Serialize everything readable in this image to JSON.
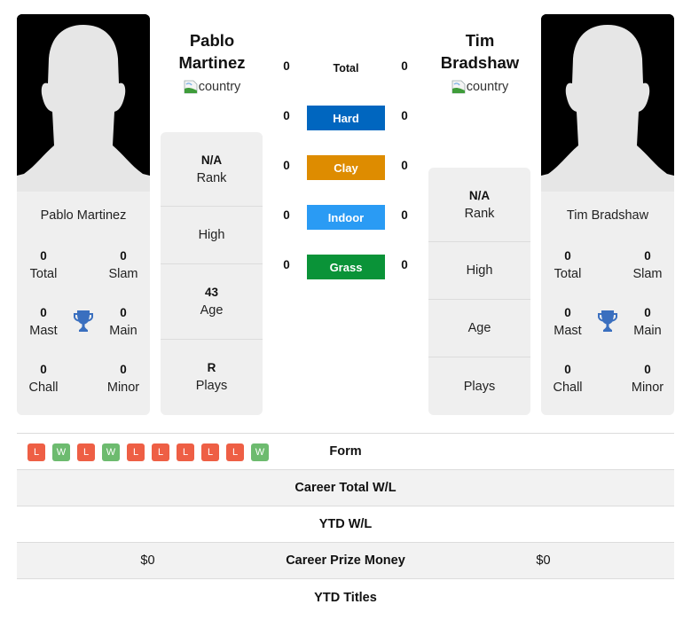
{
  "players": {
    "left": {
      "name": "Pablo Martinez",
      "name_line1": "Pablo",
      "name_line2": "Martinez",
      "country_alt": "country",
      "titles": {
        "total": {
          "value": "0",
          "label": "Total"
        },
        "slam": {
          "value": "0",
          "label": "Slam"
        },
        "mast": {
          "value": "0",
          "label": "Mast"
        },
        "main": {
          "value": "0",
          "label": "Main"
        },
        "chall": {
          "value": "0",
          "label": "Chall"
        },
        "minor": {
          "value": "0",
          "label": "Minor"
        }
      },
      "info": {
        "rank": {
          "value": "N/A",
          "label": "Rank"
        },
        "high": {
          "value": "",
          "label": "High"
        },
        "age": {
          "value": "43",
          "label": "Age"
        },
        "plays": {
          "value": "R",
          "label": "Plays"
        }
      },
      "form": [
        "L",
        "W",
        "L",
        "W",
        "L",
        "L",
        "L",
        "L",
        "L",
        "W"
      ],
      "career_wl": "",
      "ytd_wl": "",
      "prize_money": "$0",
      "ytd_titles": ""
    },
    "right": {
      "name": "Tim Bradshaw",
      "name_line1": "Tim",
      "name_line2": "Bradshaw",
      "country_alt": "country",
      "titles": {
        "total": {
          "value": "0",
          "label": "Total"
        },
        "slam": {
          "value": "0",
          "label": "Slam"
        },
        "mast": {
          "value": "0",
          "label": "Mast"
        },
        "main": {
          "value": "0",
          "label": "Main"
        },
        "chall": {
          "value": "0",
          "label": "Chall"
        },
        "minor": {
          "value": "0",
          "label": "Minor"
        }
      },
      "info": {
        "rank": {
          "value": "N/A",
          "label": "Rank"
        },
        "high": {
          "value": "",
          "label": "High"
        },
        "age": {
          "value": "",
          "label": "Age"
        },
        "plays": {
          "value": "",
          "label": "Plays"
        }
      },
      "career_wl": "",
      "ytd_wl": "",
      "prize_money": "$0",
      "ytd_titles": ""
    }
  },
  "surfaces": [
    {
      "name": "Total",
      "left": "0",
      "right": "0",
      "color": ""
    },
    {
      "name": "Hard",
      "left": "0",
      "right": "0",
      "color": "#0066bf"
    },
    {
      "name": "Clay",
      "left": "0",
      "right": "0",
      "color": "#de8c00"
    },
    {
      "name": "Indoor",
      "left": "0",
      "right": "0",
      "color": "#2a9bf4"
    },
    {
      "name": "Grass",
      "left": "0",
      "right": "0",
      "color": "#0a9338"
    }
  ],
  "stats_rows": {
    "form": "Form",
    "career_wl": "Career Total W/L",
    "ytd_wl": "YTD W/L",
    "prize_money": "Career Prize Money",
    "ytd_titles": "YTD Titles"
  },
  "colors": {
    "loss": "#ee5f45",
    "win": "#6dbb6f",
    "trophy": "#3a6fbf"
  }
}
